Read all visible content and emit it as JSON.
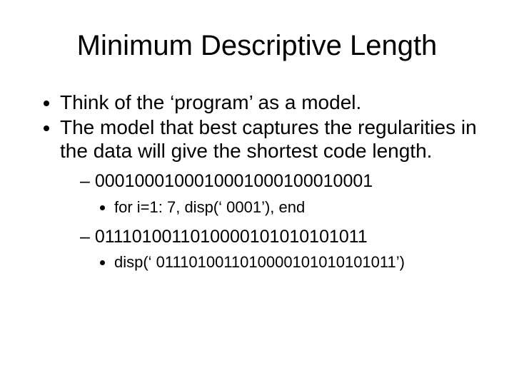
{
  "title": "Minimum Descriptive Length",
  "bullets": {
    "b1": "Think of the ‘program’ as a model.",
    "b2": "The model that best captures the regularities in the data will give the shortest code length.",
    "s1": "0001000100010001000100010001",
    "s1code": "for i=1: 7, disp(‘ 0001’), end",
    "s2": "0111010011010000101010101011",
    "s2code": "disp(‘ 0111010011010000101010101011’)"
  }
}
